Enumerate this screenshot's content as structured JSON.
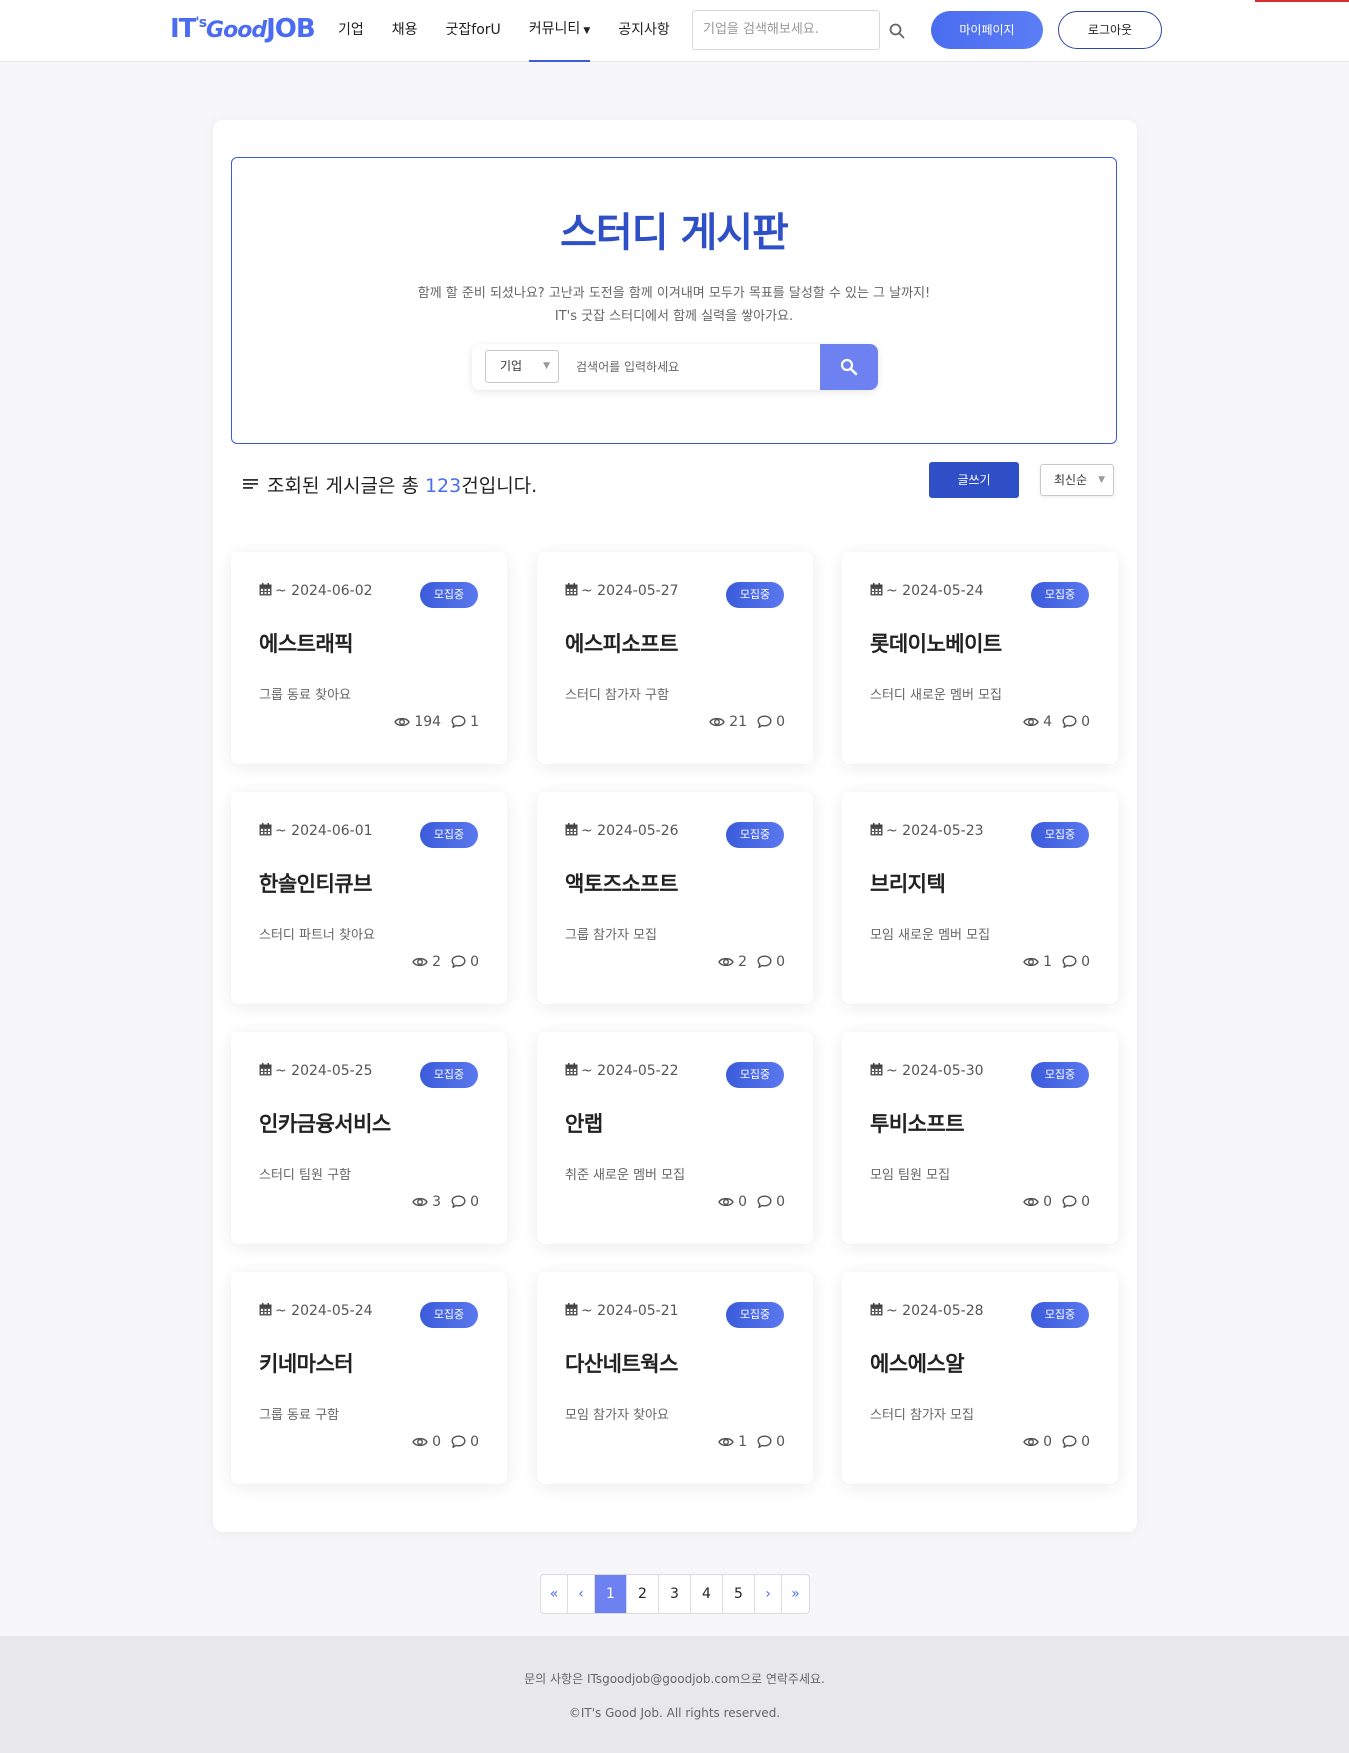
{
  "header": {
    "logo": {
      "a": "IT",
      "b": "'s",
      "c": "Good",
      "d": "JOB"
    },
    "nav": [
      {
        "label": "기업"
      },
      {
        "label": "채용"
      },
      {
        "label": "굿잡forU"
      },
      {
        "label": "커뮤니티",
        "dropdown": true,
        "active": true
      },
      {
        "label": "공지사항"
      }
    ],
    "search_placeholder": "기업을 검색해보세요.",
    "mypage_label": "마이페이지",
    "logout_label": "로그아웃"
  },
  "hero": {
    "title": "스터디 게시판",
    "desc_line1": "함께 할 준비 되셨나요? 고난과 도전을 함께 이겨내며 모두가 목표를 달성할 수 있는 그 날까지!",
    "desc_line2": "IT's 굿잡 스터디에서 함께 실력을 쌓아가요.",
    "search_category": "기업",
    "search_placeholder": "검색어를 입력하세요"
  },
  "list": {
    "count_prefix": "조회된 게시글은 총 ",
    "count": "123",
    "count_suffix": "건입니다.",
    "write_label": "글쓰기",
    "sort_label": "최신순"
  },
  "cards": [
    {
      "date": "~ 2024-06-02",
      "badge": "모집중",
      "title": "에스트래픽",
      "desc": "그룹 동료 찾아요",
      "views": "194",
      "comments": "1"
    },
    {
      "date": "~ 2024-05-27",
      "badge": "모집중",
      "title": "에스피소프트",
      "desc": "스터디 참가자 구함",
      "views": "21",
      "comments": "0"
    },
    {
      "date": "~ 2024-05-24",
      "badge": "모집중",
      "title": "롯데이노베이트",
      "desc": "스터디 새로운 멤버 모집",
      "views": "4",
      "comments": "0"
    },
    {
      "date": "~ 2024-06-01",
      "badge": "모집중",
      "title": "한솔인티큐브",
      "desc": "스터디 파트너 찾아요",
      "views": "2",
      "comments": "0"
    },
    {
      "date": "~ 2024-05-26",
      "badge": "모집중",
      "title": "액토즈소프트",
      "desc": "그룹 참가자 모집",
      "views": "2",
      "comments": "0"
    },
    {
      "date": "~ 2024-05-23",
      "badge": "모집중",
      "title": "브리지텍",
      "desc": "모임 새로운 멤버 모집",
      "views": "1",
      "comments": "0"
    },
    {
      "date": "~ 2024-05-25",
      "badge": "모집중",
      "title": "인카금융서비스",
      "desc": "스터디 팀원 구함",
      "views": "3",
      "comments": "0"
    },
    {
      "date": "~ 2024-05-22",
      "badge": "모집중",
      "title": "안랩",
      "desc": "취준 새로운 멤버 모집",
      "views": "0",
      "comments": "0"
    },
    {
      "date": "~ 2024-05-30",
      "badge": "모집중",
      "title": "투비소프트",
      "desc": "모임 팀원 모집",
      "views": "0",
      "comments": "0"
    },
    {
      "date": "~ 2024-05-24",
      "badge": "모집중",
      "title": "키네마스터",
      "desc": "그룹 동료 구함",
      "views": "0",
      "comments": "0"
    },
    {
      "date": "~ 2024-05-21",
      "badge": "모집중",
      "title": "다산네트웍스",
      "desc": "모임 참가자 찾아요",
      "views": "1",
      "comments": "0"
    },
    {
      "date": "~ 2024-05-28",
      "badge": "모집중",
      "title": "에스에스알",
      "desc": "스터디 참가자 모집",
      "views": "0",
      "comments": "0"
    }
  ],
  "pagination": {
    "first": "«",
    "prev": "‹",
    "pages": [
      "1",
      "2",
      "3",
      "4",
      "5"
    ],
    "current": "1",
    "next": "›",
    "last": "»"
  },
  "footer": {
    "contact": "문의 사항은 ITsgoodjob@goodjob.com으로 연락주세요.",
    "copyright": "©IT's Good Job. All rights reserved."
  },
  "icons": {
    "search": "search-icon",
    "calendar": "calendar-icon",
    "eye": "eye-icon",
    "comment": "comment-icon",
    "list": "list-icon",
    "chevron": "chevron-down-icon"
  },
  "colors": {
    "brand": "#4a6cf0",
    "brand_dark": "#2f4fc6",
    "search_button": "#6d82f0"
  }
}
